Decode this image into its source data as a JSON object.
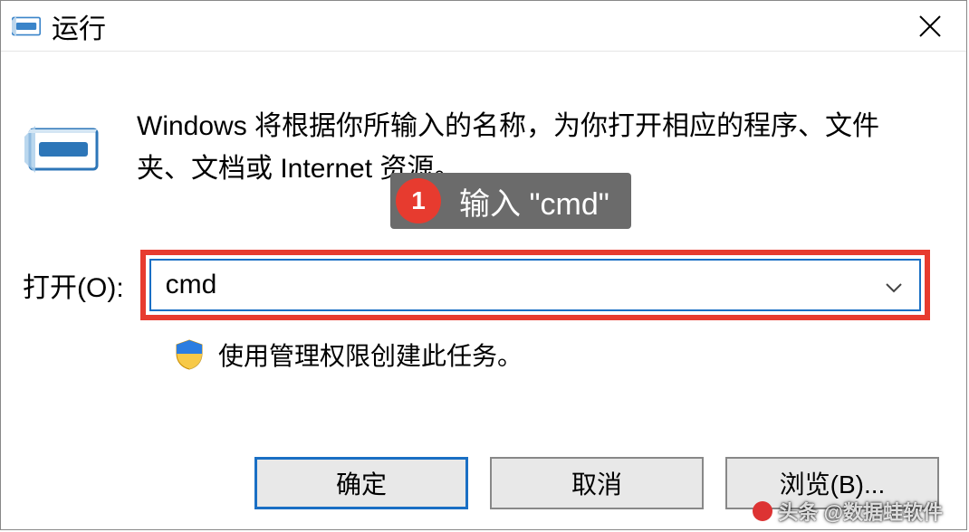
{
  "titlebar": {
    "title": "运行"
  },
  "description": "Windows 将根据你所输入的名称，为你打开相应的程序、文件夹、文档或 Internet 资源。",
  "annotation": {
    "badge": "1",
    "text": "输入 \"cmd\""
  },
  "open": {
    "label": "打开(O):",
    "value": "cmd"
  },
  "admin_note": "使用管理权限创建此任务。",
  "buttons": {
    "ok": "确定",
    "cancel": "取消",
    "browse": "浏览(B)..."
  },
  "watermark": "头条 @数据蛙软件"
}
